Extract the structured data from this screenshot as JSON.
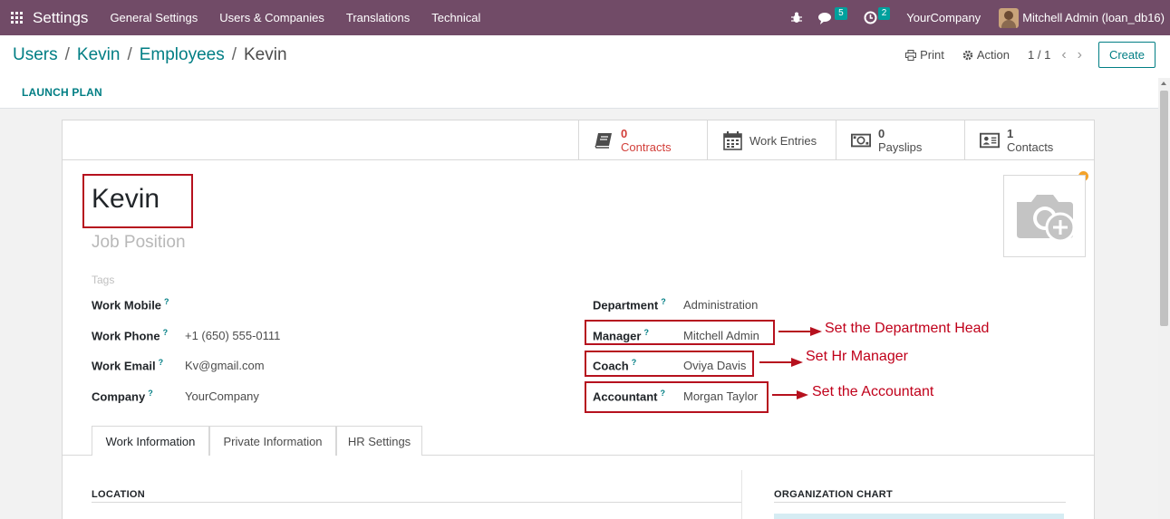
{
  "navbar": {
    "app_name": "Settings",
    "menu": [
      "General Settings",
      "Users & Companies",
      "Translations",
      "Technical"
    ],
    "messages_count": "5",
    "activities_count": "2",
    "company": "YourCompany",
    "user": "Mitchell Admin (loan_db16)"
  },
  "breadcrumb": {
    "items": [
      "Users",
      "Kevin",
      "Employees"
    ],
    "separator": "/",
    "current": "Kevin"
  },
  "actions": {
    "print": "Print",
    "action": "Action",
    "pager": "1 / 1",
    "prev": "‹",
    "next": "›",
    "create": "Create",
    "launch_plan": "LAUNCH PLAN"
  },
  "smart_buttons": [
    {
      "value": "0",
      "label": "Contracts",
      "icon": "book-icon"
    },
    {
      "label": "Work Entries",
      "icon": "calendar-icon"
    },
    {
      "value": "0",
      "label": "Payslips",
      "icon": "money-icon"
    },
    {
      "value": "1",
      "label": "Contacts",
      "icon": "address-card-icon"
    }
  ],
  "employee": {
    "name": "Kevin",
    "job_position_placeholder": "Job Position",
    "tags_placeholder": "Tags"
  },
  "fields_left": [
    {
      "label": "Work Mobile",
      "help": "?",
      "value": ""
    },
    {
      "label": "Work Phone",
      "help": "?",
      "value": "+1 (650) 555-0111"
    },
    {
      "label": "Work Email",
      "help": "?",
      "value": "Kv@gmail.com"
    },
    {
      "label": "Company",
      "help": "?",
      "value": "YourCompany"
    }
  ],
  "fields_right": [
    {
      "label": "Department",
      "help": "?",
      "value": "Administration"
    },
    {
      "label": "Manager",
      "help": "?",
      "value": "Mitchell Admin"
    },
    {
      "label": "Coach",
      "help": "?",
      "value": "Oviya Davis"
    },
    {
      "label": "Accountant",
      "help": "?",
      "value": "Morgan Taylor"
    }
  ],
  "tabs": [
    "Work Information",
    "Private Information",
    "HR Settings"
  ],
  "sections": {
    "location": "LOCATION",
    "org_chart": "ORGANIZATION CHART"
  },
  "annotations": {
    "manager": "Set the Department Head",
    "coach": "Set Hr Manager",
    "accountant": "Set the Accountant"
  },
  "colors": {
    "navbar": "#714b67",
    "primary": "#017e84",
    "annotation": "#b6111e",
    "stat_red": "#d23f3a"
  }
}
